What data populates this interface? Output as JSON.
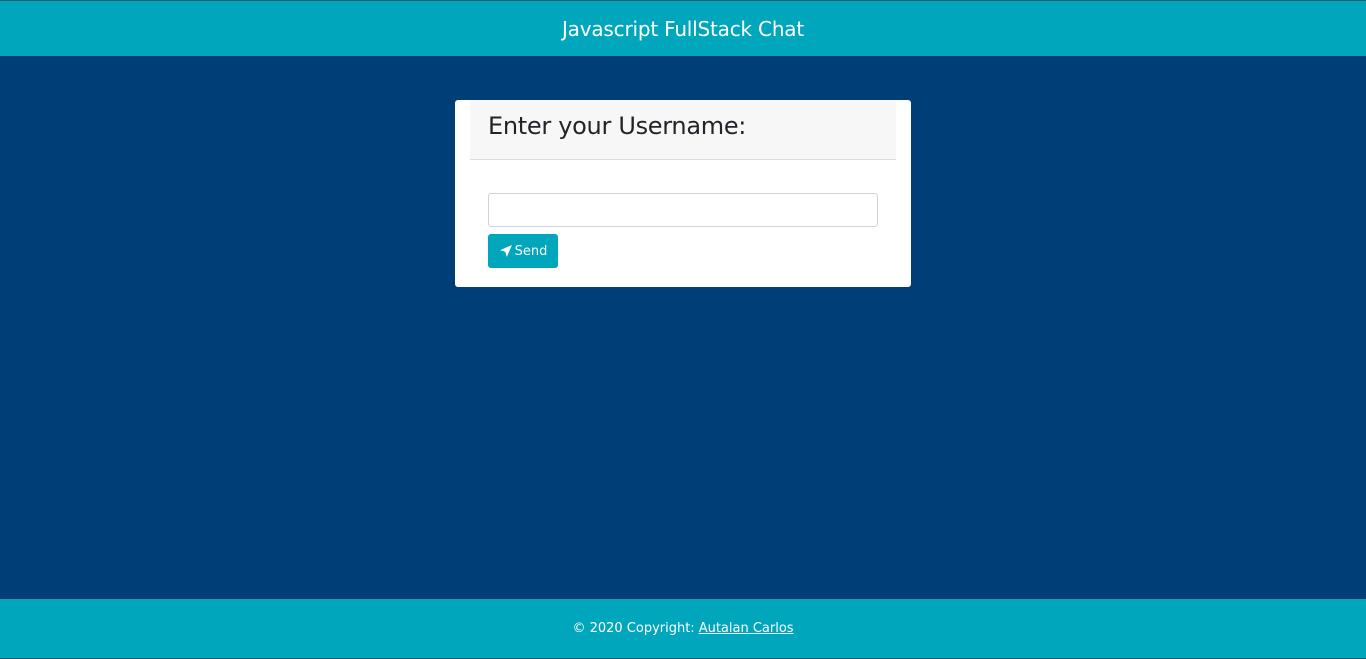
{
  "header": {
    "title": "Javascript FullStack Chat"
  },
  "login_card": {
    "title": "Enter your Username:",
    "username_input": {
      "value": "",
      "placeholder": ""
    },
    "send_button": {
      "label": "Send",
      "icon": "paper-plane-icon"
    }
  },
  "footer": {
    "copyright_text": "© 2020 Copyright:",
    "author_link": "Autalan Carlos"
  },
  "colors": {
    "background": "#003e78",
    "accent": "#00a6bb",
    "card": "#ffffff",
    "card_header": "#f7f7f7"
  }
}
